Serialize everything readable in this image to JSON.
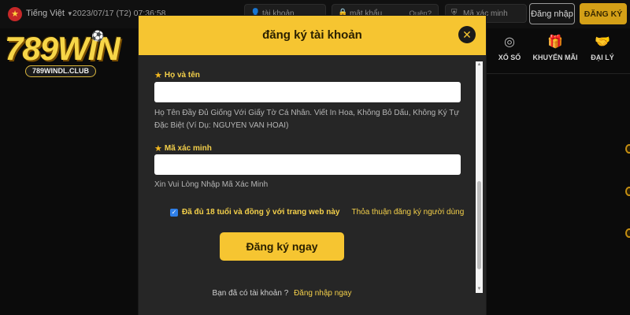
{
  "topbar": {
    "language": "Tiếng Việt",
    "datetime": "2023/07/17 (T2) 07:36:58",
    "username_placeholder": "tài khoản",
    "password_placeholder": "mật khẩu",
    "forgot_label": "Quên?",
    "captcha_placeholder": "Mã xác minh",
    "login_label": "Đăng nhập",
    "register_label": "ĐĂNG KÝ"
  },
  "logo": {
    "brand": "789WIN",
    "domain": "789WINDL.CLUB"
  },
  "nav": {
    "items": [
      {
        "label": "XỔ SỐ",
        "icon": "lottery-ball-icon"
      },
      {
        "label": "KHUYẾN MÃI",
        "icon": "gift-icon"
      },
      {
        "label": "ĐẠI LÝ",
        "icon": "handshake-icon"
      }
    ]
  },
  "modal": {
    "title": "đăng ký tài khoản",
    "fields": [
      {
        "label": "Họ và tên",
        "value": "",
        "hint": "Họ Tên Đầy Đủ Giống Với Giấy Tờ Cá Nhân. Viết In Hoa, Không Bỏ Dấu, Không Ký Tự Đặc Biệt (Ví Dụ: NGUYEN VAN HOAI)"
      },
      {
        "label": "Mã xác minh",
        "value": "",
        "hint": "Xin Vui Lòng Nhập Mã Xác Minh"
      }
    ],
    "agree_text": "Đã đủ 18 tuổi và đồng ý với trang web này",
    "agree_checked": true,
    "terms_link": "Thỏa thuận đăng ký người dùng",
    "submit_label": "Đăng ký ngay",
    "have_account_text": "Bạn đã có tài khoản ?",
    "login_link": "Đăng nhập ngay"
  },
  "colors": {
    "accent": "#f6c531",
    "label_gold": "#f3cf4a",
    "modal_bg": "#262626",
    "page_bg": "#0b0b0b",
    "checkbox_blue": "#2f7fe8"
  }
}
